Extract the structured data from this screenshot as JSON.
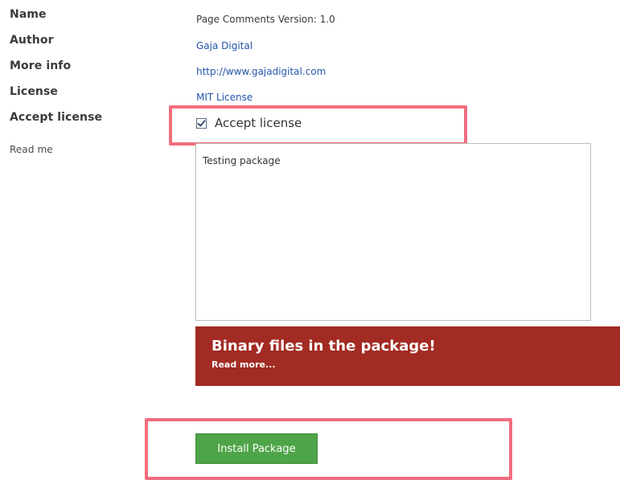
{
  "labels": {
    "name": "Name",
    "author": "Author",
    "more_info": "More info",
    "license": "License",
    "accept_license": "Accept license",
    "read_me": "Read me"
  },
  "package": {
    "name_version": "Page Comments Version: 1.0",
    "author": "Gaja Digital",
    "more_info_url": "http://www.gajadigital.com",
    "license": "MIT License"
  },
  "accept": {
    "label": "Accept license",
    "checked": true
  },
  "readme": {
    "text": "Testing package"
  },
  "warning": {
    "title": "Binary files in the package!",
    "link": "Read more..."
  },
  "install_button": {
    "label": "Install Package"
  },
  "colors": {
    "highlight": "#f26d7d",
    "warning_bg": "#a22b23",
    "button_bg": "#4ea448",
    "link": "#2255aa"
  }
}
